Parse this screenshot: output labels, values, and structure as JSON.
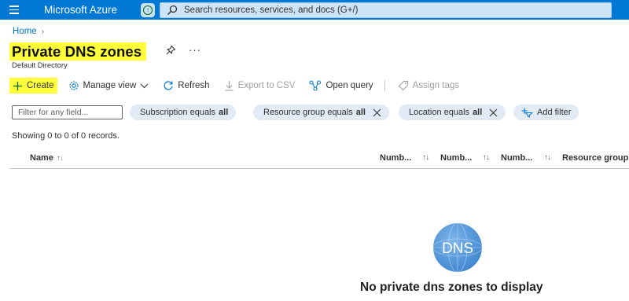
{
  "topbar": {
    "brand": "Microsoft Azure",
    "search_placeholder": "Search resources, services, and docs (G+/)",
    "bar_color": "#0078d4"
  },
  "breadcrumb": {
    "items": [
      "Home"
    ]
  },
  "page": {
    "title": "Private DNS zones",
    "subtitle": "Default Directory",
    "highlight_color": "#ffff3a"
  },
  "commands": {
    "create": "Create",
    "manage_view": "Manage view",
    "refresh": "Refresh",
    "export_csv": "Export to CSV",
    "open_query": "Open query",
    "assign_tags": "Assign tags"
  },
  "filters": {
    "search_placeholder": "Filter for any field...",
    "pills": [
      {
        "label": "Subscription equals",
        "value": "all"
      },
      {
        "label": "Resource group equals",
        "value": "all"
      },
      {
        "label": "Location equals",
        "value": "all"
      }
    ],
    "add_filter": "Add filter"
  },
  "records_text": "Showing 0 to 0 of 0 records.",
  "table": {
    "columns": [
      "Name",
      "Numb...",
      "Numb...",
      "Numb...",
      "Resource group"
    ]
  },
  "empty_state": {
    "icon_text": "DNS",
    "message": "No private dns zones to display"
  }
}
